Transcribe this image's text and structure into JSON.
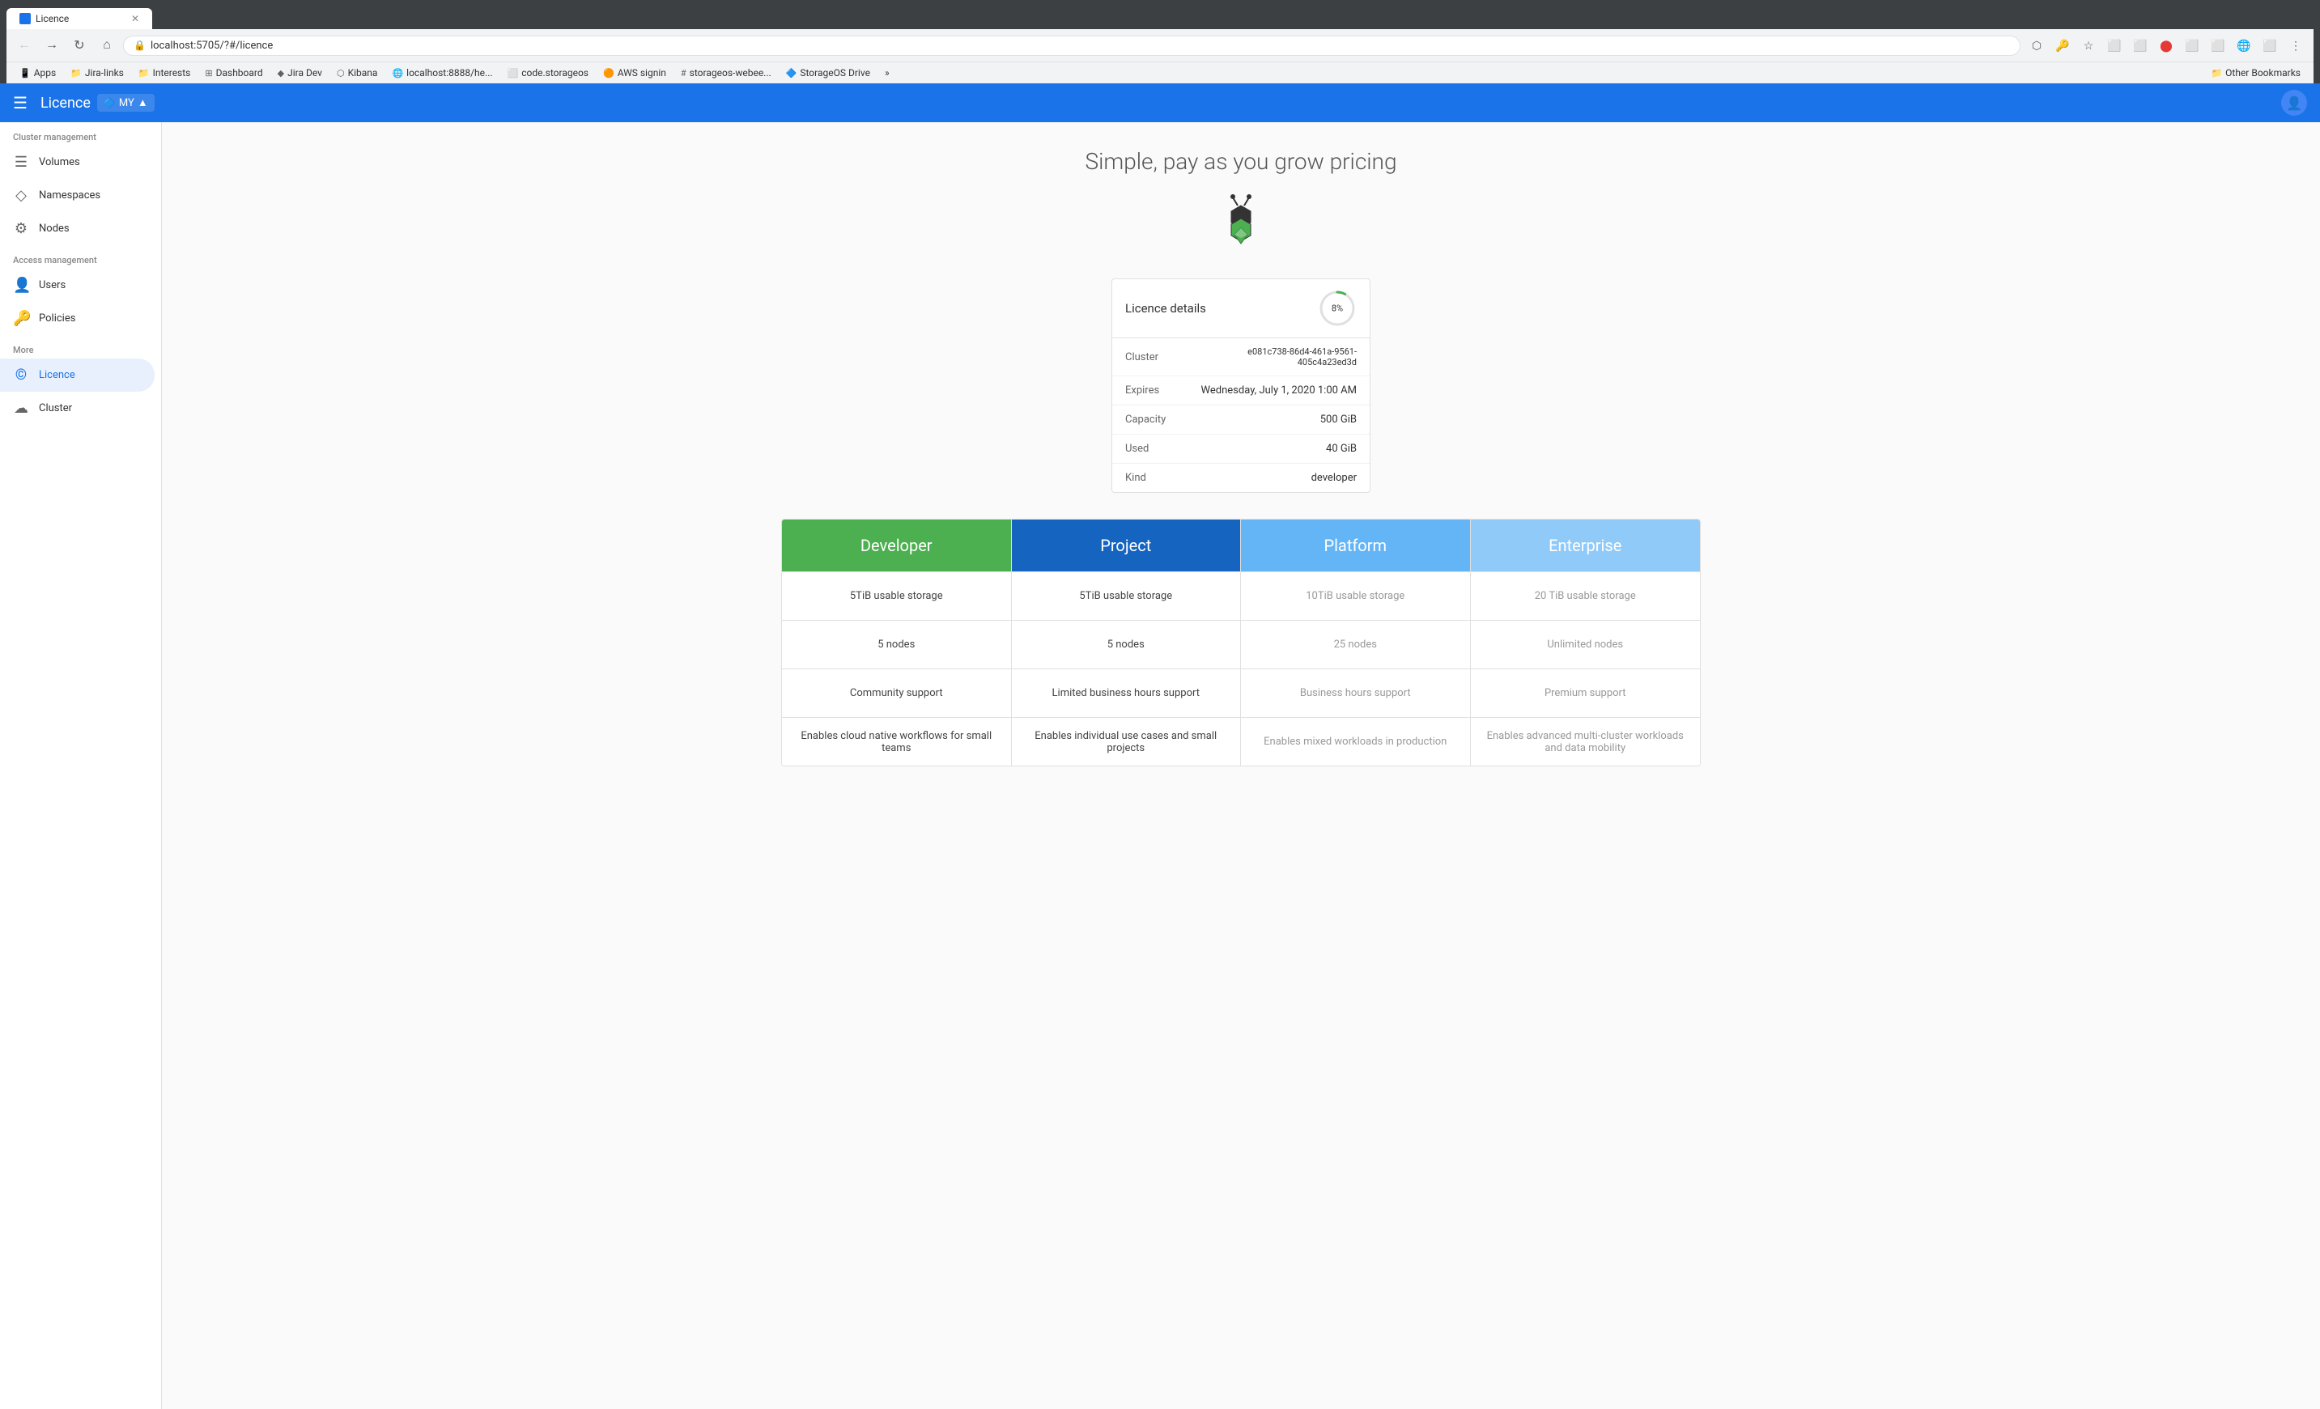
{
  "browser": {
    "url": "localhost:5705/?#/licence",
    "tab_title": "Licence"
  },
  "bookmarks": [
    {
      "label": "Apps",
      "type": "folder"
    },
    {
      "label": "Jira-links",
      "type": "folder"
    },
    {
      "label": "Interests",
      "type": "folder"
    },
    {
      "label": "Dashboard",
      "type": "link"
    },
    {
      "label": "Jira Dev",
      "type": "link"
    },
    {
      "label": "Kibana",
      "type": "link"
    },
    {
      "label": "localhost:8888/he...",
      "type": "link"
    },
    {
      "label": "code.storageos",
      "type": "link"
    },
    {
      "label": "AWS signin",
      "type": "link"
    },
    {
      "label": "storageos-webee...",
      "type": "link"
    },
    {
      "label": "StorageOS Drive",
      "type": "link"
    },
    {
      "label": "»",
      "type": "more"
    },
    {
      "label": "Other Bookmarks",
      "type": "folder"
    }
  ],
  "header": {
    "title": "Licence",
    "workspace": "MY",
    "menu_icon": "☰",
    "avatar_icon": "👤"
  },
  "sidebar": {
    "cluster_label": "Cluster management",
    "access_label": "Access management",
    "more_label": "More",
    "items": [
      {
        "id": "volumes",
        "label": "Volumes",
        "icon": "☰",
        "active": false,
        "section": "cluster"
      },
      {
        "id": "namespaces",
        "label": "Namespaces",
        "icon": "◇",
        "active": false,
        "section": "cluster"
      },
      {
        "id": "nodes",
        "label": "Nodes",
        "icon": "⚙",
        "active": false,
        "section": "cluster"
      },
      {
        "id": "users",
        "label": "Users",
        "icon": "👤",
        "active": false,
        "section": "access"
      },
      {
        "id": "policies",
        "label": "Policies",
        "icon": "🔑",
        "active": false,
        "section": "access"
      },
      {
        "id": "licence",
        "label": "Licence",
        "icon": "©",
        "active": true,
        "section": "more"
      },
      {
        "id": "cluster",
        "label": "Cluster",
        "icon": "☁",
        "active": false,
        "section": "more"
      }
    ]
  },
  "pricing": {
    "title": "Simple, pay as you grow pricing",
    "licence_card": {
      "title": "Licence details",
      "progress_percent": "8%",
      "progress_value": 8,
      "fields": [
        {
          "label": "Cluster",
          "value": "e081c738-86d4-461a-9561-405c4a23ed3d"
        },
        {
          "label": "Expires",
          "value": "Wednesday, July 1, 2020 1:00 AM"
        },
        {
          "label": "Capacity",
          "value": "500 GiB"
        },
        {
          "label": "Used",
          "value": "40 GiB"
        },
        {
          "label": "Kind",
          "value": "developer"
        }
      ]
    },
    "plans": [
      {
        "id": "developer",
        "name": "Developer",
        "color_class": "developer",
        "features": [
          "5TiB usable storage",
          "5 nodes",
          "Community support",
          "Enables cloud native workflows for small teams"
        ]
      },
      {
        "id": "project",
        "name": "Project",
        "color_class": "project",
        "features": [
          "5TiB usable storage",
          "5 nodes",
          "Limited business hours support",
          "Enables individual use cases and small projects"
        ]
      },
      {
        "id": "platform",
        "name": "Platform",
        "color_class": "platform",
        "features": [
          "10TiB usable storage",
          "25 nodes",
          "Business hours support",
          "Enables mixed workloads in production"
        ]
      },
      {
        "id": "enterprise",
        "name": "Enterprise",
        "color_class": "enterprise",
        "features": [
          "20 TiB usable storage",
          "Unlimited nodes",
          "Premium support",
          "Enables advanced multi-cluster workloads and data mobility"
        ]
      }
    ]
  }
}
